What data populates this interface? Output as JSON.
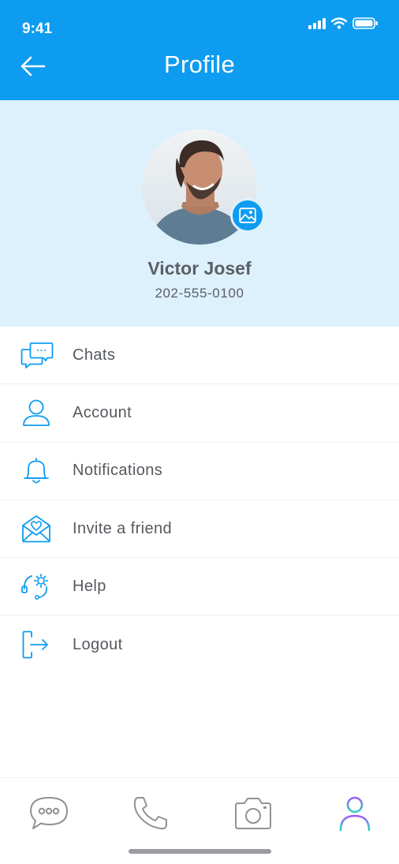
{
  "status_bar": {
    "time": "9:41"
  },
  "header": {
    "title": "Profile"
  },
  "profile": {
    "name": "Victor Josef",
    "phone": "202-555-0100"
  },
  "menu": {
    "items": [
      {
        "label": "Chats",
        "icon": "chat-bubbles-icon"
      },
      {
        "label": "Account",
        "icon": "user-icon"
      },
      {
        "label": "Notifications",
        "icon": "bell-icon"
      },
      {
        "label": "Invite a friend",
        "icon": "envelope-heart-icon"
      },
      {
        "label": "Help",
        "icon": "headset-gear-icon"
      },
      {
        "label": "Logout",
        "icon": "logout-icon"
      }
    ]
  },
  "tabbar": {
    "tabs": [
      {
        "name": "chat",
        "icon": "chat-icon",
        "active": false
      },
      {
        "name": "call",
        "icon": "phone-icon",
        "active": false
      },
      {
        "name": "camera",
        "icon": "camera-icon",
        "active": false
      },
      {
        "name": "profile",
        "icon": "profile-icon",
        "active": true
      }
    ]
  },
  "colors": {
    "primary": "#0e9cf0",
    "profile_background": "#ddf1fd",
    "text": "#55595e",
    "tab_inactive": "#8f9296",
    "tab_active_gradient": [
      "#a259f7",
      "#2dd4bf"
    ]
  }
}
